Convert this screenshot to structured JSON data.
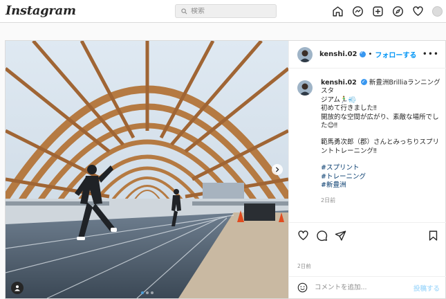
{
  "app": {
    "logo": "Instagram"
  },
  "search": {
    "placeholder": "検索"
  },
  "nav": {
    "icons": [
      "home-icon",
      "messenger-icon",
      "new-post-icon",
      "explore-icon",
      "activity-heart-icon",
      "profile-avatar"
    ]
  },
  "post": {
    "username": "kenshi.02",
    "separator": "•",
    "follow_label": "フォローする",
    "more_label": "•••",
    "caption_lines": [
      "新豊洲Brilliaランニングスタ",
      "ジアム🏃‍♂️💨",
      "初めて行きました‼︎",
      "開放的な空間が広がり、素敵な場所でし",
      "た😊‼︎"
    ],
    "caption_lines_2": [
      "範馬勇次郎（郡）さんとみっちりスプリ",
      "ントトレーニング‼︎"
    ],
    "hashtags": [
      "#スプリント",
      "#トレーニング",
      "#新豊洲"
    ],
    "caption_age": "2日前",
    "date": "2日前",
    "comment_placeholder": "コメントを追加...",
    "post_button": "投稿する",
    "carousel": {
      "count": 3,
      "active_index": 0
    }
  },
  "colors": {
    "link": "#0095f6",
    "hashtag": "#00376b",
    "verified": "#3897f0",
    "muted": "#8e8e8e"
  }
}
